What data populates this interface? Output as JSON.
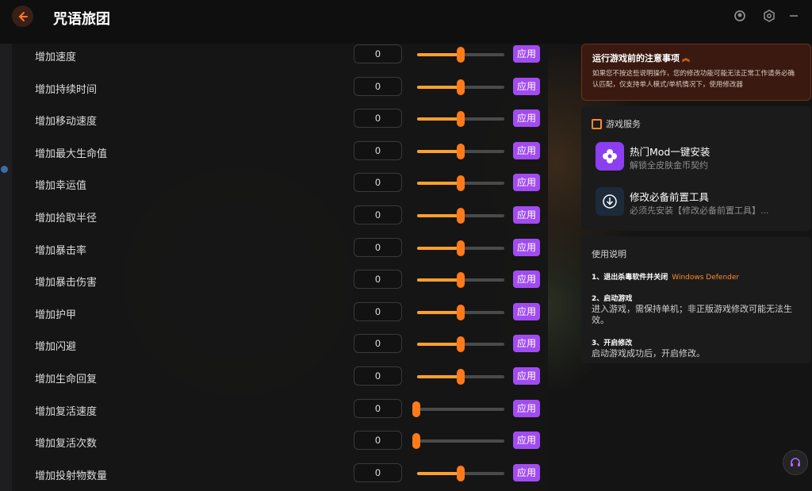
{
  "window": {
    "title": "咒语旅团",
    "back_icon": "back-arrow-icon",
    "icons": [
      "user-icon",
      "settings-icon",
      "minimize-icon"
    ]
  },
  "mods": [
    {
      "label": "增加速度",
      "value": "0",
      "level": 0.5,
      "apply": "应用"
    },
    {
      "label": "增加持续时间",
      "value": "0",
      "level": 0.5,
      "apply": "应用"
    },
    {
      "label": "增加移动速度",
      "value": "0",
      "level": 0.5,
      "apply": "应用"
    },
    {
      "label": "增加最大生命值",
      "value": "0",
      "level": 0.5,
      "apply": "应用"
    },
    {
      "label": "增加幸运值",
      "value": "0",
      "level": 0.5,
      "apply": "应用"
    },
    {
      "label": "增加拾取半径",
      "value": "0",
      "level": 0.5,
      "apply": "应用"
    },
    {
      "label": "增加暴击率",
      "value": "0",
      "level": 0.5,
      "apply": "应用"
    },
    {
      "label": "增加暴击伤害",
      "value": "0",
      "level": 0.5,
      "apply": "应用"
    },
    {
      "label": "增加护甲",
      "value": "0",
      "level": 0.5,
      "apply": "应用"
    },
    {
      "label": "增加闪避",
      "value": "0",
      "level": 0.5,
      "apply": "应用"
    },
    {
      "label": "增加生命回复",
      "value": "0",
      "level": 0.5,
      "apply": "应用"
    },
    {
      "label": "增加复活速度",
      "value": "0",
      "level": 0.0,
      "apply": "应用"
    },
    {
      "label": "增加复活次数",
      "value": "0",
      "level": 0.0,
      "apply": "应用"
    },
    {
      "label": "增加投射物数量",
      "value": "0",
      "level": 0.5,
      "apply": "应用"
    }
  ],
  "notice": {
    "title": "运行游戏前的注意事项",
    "text": "如果您不按这些说明操作，您的修改功能可能无法正常工作请务必确认匹配，仅支持单人模式/单机情况下，使用修改器"
  },
  "services": {
    "header": "游戏服务",
    "items": [
      {
        "title": "热门Mod一键安装",
        "subtitle": "解锁全皮肤金币契约",
        "icon": "mod-flower-icon"
      },
      {
        "title": "修改必备前置工具",
        "subtitle": "必须先安装【修改必备前置工具】...",
        "icon": "download-icon"
      }
    ]
  },
  "instructions": {
    "title": "使用说明",
    "steps": [
      {
        "head": "1、退出杀毒软件并关闭",
        "highlight": "Windows Defender",
        "body": ""
      },
      {
        "head": "2、启动游戏",
        "highlight": "",
        "body": "进入游戏，需保持单机；非正版游戏修改可能无法生效。"
      },
      {
        "head": "3、开启修改",
        "highlight": "",
        "body": "启动游戏成功后，开启修改。"
      }
    ]
  },
  "colors": {
    "accent_orange": "#ff7a1a",
    "apply_purple": "#a14cf0",
    "background": "#151516"
  },
  "float_button_icon": "headset-icon"
}
